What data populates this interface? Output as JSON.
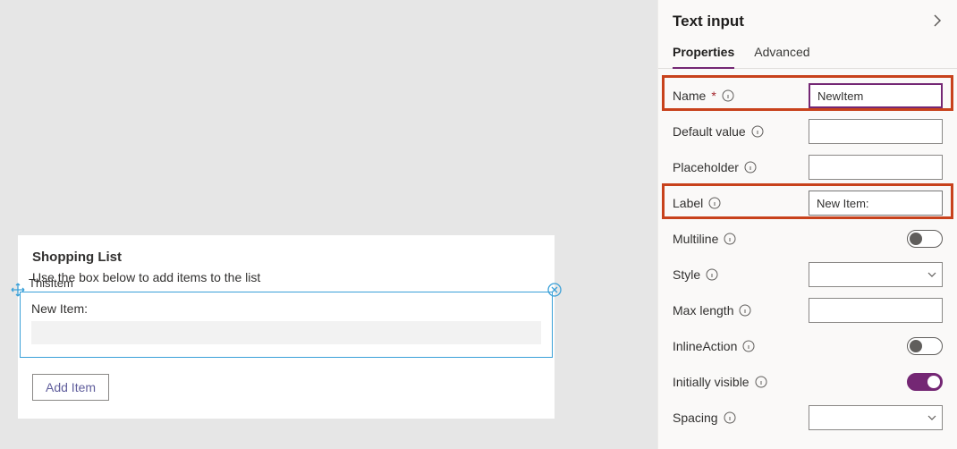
{
  "panel": {
    "title": "Text input",
    "tabs": {
      "properties": "Properties",
      "advanced": "Advanced"
    },
    "props": {
      "name": {
        "label": "Name",
        "required_marker": "*",
        "value": "NewItem"
      },
      "default_value": {
        "label": "Default value",
        "value": ""
      },
      "placeholder": {
        "label": "Placeholder",
        "value": ""
      },
      "label": {
        "label": "Label",
        "value": "New Item:"
      },
      "multiline": {
        "label": "Multiline"
      },
      "style": {
        "label": "Style"
      },
      "max_length": {
        "label": "Max length",
        "value": ""
      },
      "inline_action": {
        "label": "InlineAction"
      },
      "initially_visible": {
        "label": "Initially visible"
      },
      "spacing": {
        "label": "Spacing"
      }
    }
  },
  "card": {
    "title": "Shopping List",
    "subtitle": "Use the box below to add items to the list",
    "selected_name": "ThisItem",
    "field_label": "New Item:",
    "add_button": "Add Item"
  }
}
